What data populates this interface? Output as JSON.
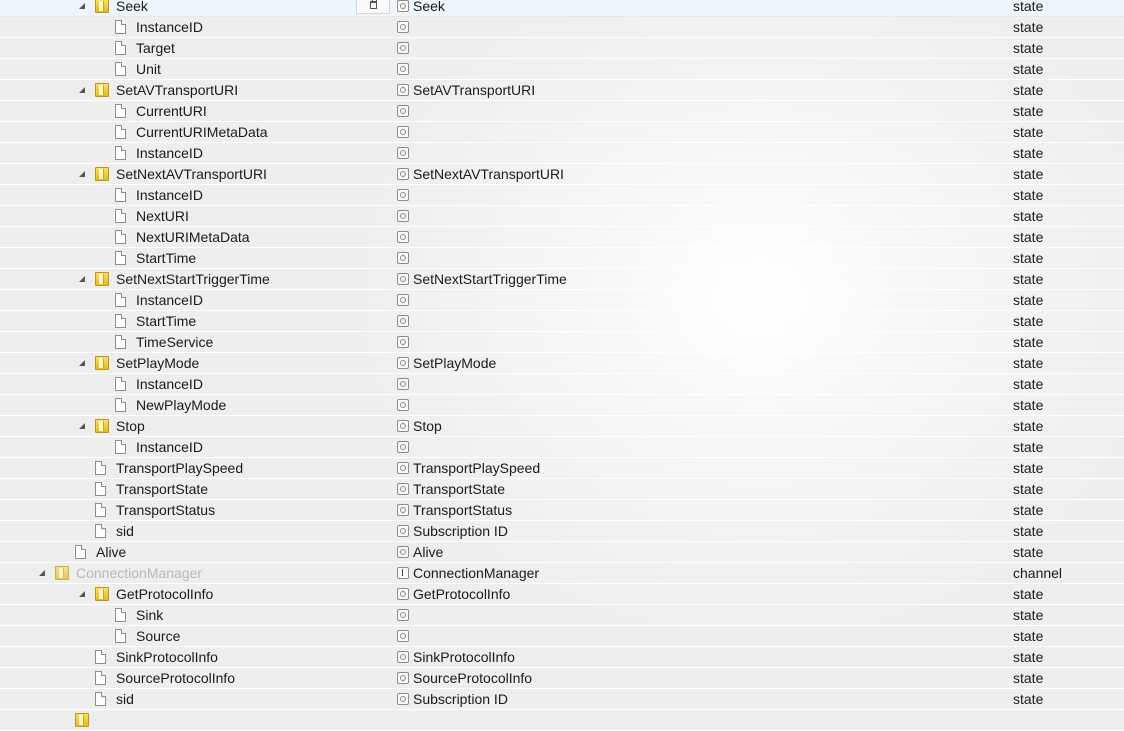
{
  "rows": [
    {
      "id": "seek",
      "label": "Seek",
      "level": 2,
      "kind": "folder",
      "expanded": true,
      "selected": true,
      "role_icon": "role-state-icon",
      "name": "Seek",
      "type": "state"
    },
    {
      "id": "seek-instanceid",
      "label": "InstanceID",
      "level": 3,
      "kind": "file",
      "role_icon": "role-state-icon",
      "name": "",
      "type": "state"
    },
    {
      "id": "seek-target",
      "label": "Target",
      "level": 3,
      "kind": "file",
      "role_icon": "role-state-icon",
      "name": "",
      "type": "state"
    },
    {
      "id": "seek-unit",
      "label": "Unit",
      "level": 3,
      "kind": "file",
      "role_icon": "role-state-icon",
      "name": "",
      "type": "state"
    },
    {
      "id": "setavtransporturi",
      "label": "SetAVTransportURI",
      "level": 2,
      "kind": "folder",
      "expanded": true,
      "role_icon": "role-state-icon",
      "name": "SetAVTransportURI",
      "type": "state"
    },
    {
      "id": "setavtransporturi-currenturi",
      "label": "CurrentURI",
      "level": 3,
      "kind": "file",
      "role_icon": "role-state-icon",
      "name": "",
      "type": "state"
    },
    {
      "id": "setavtransporturi-currenturimetadata",
      "label": "CurrentURIMetaData",
      "level": 3,
      "kind": "file",
      "role_icon": "role-state-icon",
      "name": "",
      "type": "state"
    },
    {
      "id": "setavtransporturi-instanceid",
      "label": "InstanceID",
      "level": 3,
      "kind": "file",
      "role_icon": "role-state-icon",
      "name": "",
      "type": "state"
    },
    {
      "id": "setnextavtransporturi",
      "label": "SetNextAVTransportURI",
      "level": 2,
      "kind": "folder",
      "expanded": true,
      "role_icon": "role-state-icon",
      "name": "SetNextAVTransportURI",
      "type": "state"
    },
    {
      "id": "setnextavtransporturi-instanceid",
      "label": "InstanceID",
      "level": 3,
      "kind": "file",
      "role_icon": "role-state-icon",
      "name": "",
      "type": "state"
    },
    {
      "id": "setnextavtransporturi-nexturi",
      "label": "NextURI",
      "level": 3,
      "kind": "file",
      "role_icon": "role-state-icon",
      "name": "",
      "type": "state"
    },
    {
      "id": "setnextavtransporturi-nexturimetadata",
      "label": "NextURIMetaData",
      "level": 3,
      "kind": "file",
      "role_icon": "role-state-icon",
      "name": "",
      "type": "state"
    },
    {
      "id": "setnextavtransporturi-starttime",
      "label": "StartTime",
      "level": 3,
      "kind": "file",
      "role_icon": "role-state-icon",
      "name": "",
      "type": "state"
    },
    {
      "id": "setnextstarttriggertime",
      "label": "SetNextStartTriggerTime",
      "level": 2,
      "kind": "folder",
      "expanded": true,
      "role_icon": "role-state-icon",
      "name": "SetNextStartTriggerTime",
      "type": "state"
    },
    {
      "id": "setnextstarttriggertime-instanceid",
      "label": "InstanceID",
      "level": 3,
      "kind": "file",
      "role_icon": "role-state-icon",
      "name": "",
      "type": "state"
    },
    {
      "id": "setnextstarttriggertime-starttime",
      "label": "StartTime",
      "level": 3,
      "kind": "file",
      "role_icon": "role-state-icon",
      "name": "",
      "type": "state"
    },
    {
      "id": "setnextstarttriggertime-timeservice",
      "label": "TimeService",
      "level": 3,
      "kind": "file",
      "role_icon": "role-state-icon",
      "name": "",
      "type": "state"
    },
    {
      "id": "setplaymode",
      "label": "SetPlayMode",
      "level": 2,
      "kind": "folder",
      "expanded": true,
      "role_icon": "role-state-icon",
      "name": "SetPlayMode",
      "type": "state"
    },
    {
      "id": "setplaymode-instanceid",
      "label": "InstanceID",
      "level": 3,
      "kind": "file",
      "role_icon": "role-state-icon",
      "name": "",
      "type": "state"
    },
    {
      "id": "setplaymode-newplaymode",
      "label": "NewPlayMode",
      "level": 3,
      "kind": "file",
      "role_icon": "role-state-icon",
      "name": "",
      "type": "state"
    },
    {
      "id": "stop",
      "label": "Stop",
      "level": 2,
      "kind": "folder",
      "expanded": true,
      "role_icon": "role-state-icon",
      "name": "Stop",
      "type": "state"
    },
    {
      "id": "stop-instanceid",
      "label": "InstanceID",
      "level": 3,
      "kind": "file",
      "role_icon": "role-state-icon",
      "name": "",
      "type": "state"
    },
    {
      "id": "transportplayspeed",
      "label": "TransportPlaySpeed",
      "level": 2,
      "kind": "file",
      "role_icon": "role-state-icon",
      "name": "TransportPlaySpeed",
      "type": "state"
    },
    {
      "id": "transportstate",
      "label": "TransportState",
      "level": 2,
      "kind": "file",
      "role_icon": "role-state-icon",
      "name": "TransportState",
      "type": "state"
    },
    {
      "id": "transportstatus",
      "label": "TransportStatus",
      "level": 2,
      "kind": "file",
      "role_icon": "role-state-icon",
      "name": "TransportStatus",
      "type": "state"
    },
    {
      "id": "avtransport-sid",
      "label": "sid",
      "level": 2,
      "kind": "file",
      "role_icon": "role-state-icon",
      "name": "Subscription ID",
      "type": "state"
    },
    {
      "id": "alive",
      "label": "Alive",
      "level": 1,
      "kind": "file",
      "role_icon": "role-state-icon",
      "name": "Alive",
      "type": "state"
    },
    {
      "id": "connectionmanager",
      "label": "ConnectionManager",
      "level": 0,
      "kind": "folder",
      "expanded": true,
      "muted": true,
      "role_icon": "role-channel-icon",
      "name": "ConnectionManager",
      "type": "channel"
    },
    {
      "id": "getprotocolinfo",
      "label": "GetProtocolInfo",
      "level": 2,
      "kind": "folder",
      "expanded": true,
      "role_icon": "role-state-icon",
      "name": "GetProtocolInfo",
      "type": "state"
    },
    {
      "id": "getprotocolinfo-sink",
      "label": "Sink",
      "level": 3,
      "kind": "file",
      "role_icon": "role-state-icon",
      "name": "",
      "type": "state"
    },
    {
      "id": "getprotocolinfo-source",
      "label": "Source",
      "level": 3,
      "kind": "file",
      "role_icon": "role-state-icon",
      "name": "",
      "type": "state"
    },
    {
      "id": "sinkprotocolinfo",
      "label": "SinkProtocolInfo",
      "level": 2,
      "kind": "file",
      "role_icon": "role-state-icon",
      "name": "SinkProtocolInfo",
      "type": "state"
    },
    {
      "id": "sourceprotocolinfo",
      "label": "SourceProtocolInfo",
      "level": 2,
      "kind": "file",
      "role_icon": "role-state-icon",
      "name": "SourceProtocolInfo",
      "type": "state"
    },
    {
      "id": "connectionmanager-sid",
      "label": "sid",
      "level": 2,
      "kind": "file",
      "role_icon": "role-state-icon",
      "name": "Subscription ID",
      "type": "state"
    },
    {
      "id": "next-folder-partial",
      "label": "",
      "level": 1,
      "kind": "folder",
      "role_icon": "",
      "name": "",
      "type": ""
    }
  ],
  "selected_row_action": {
    "icon": "trash-icon"
  }
}
